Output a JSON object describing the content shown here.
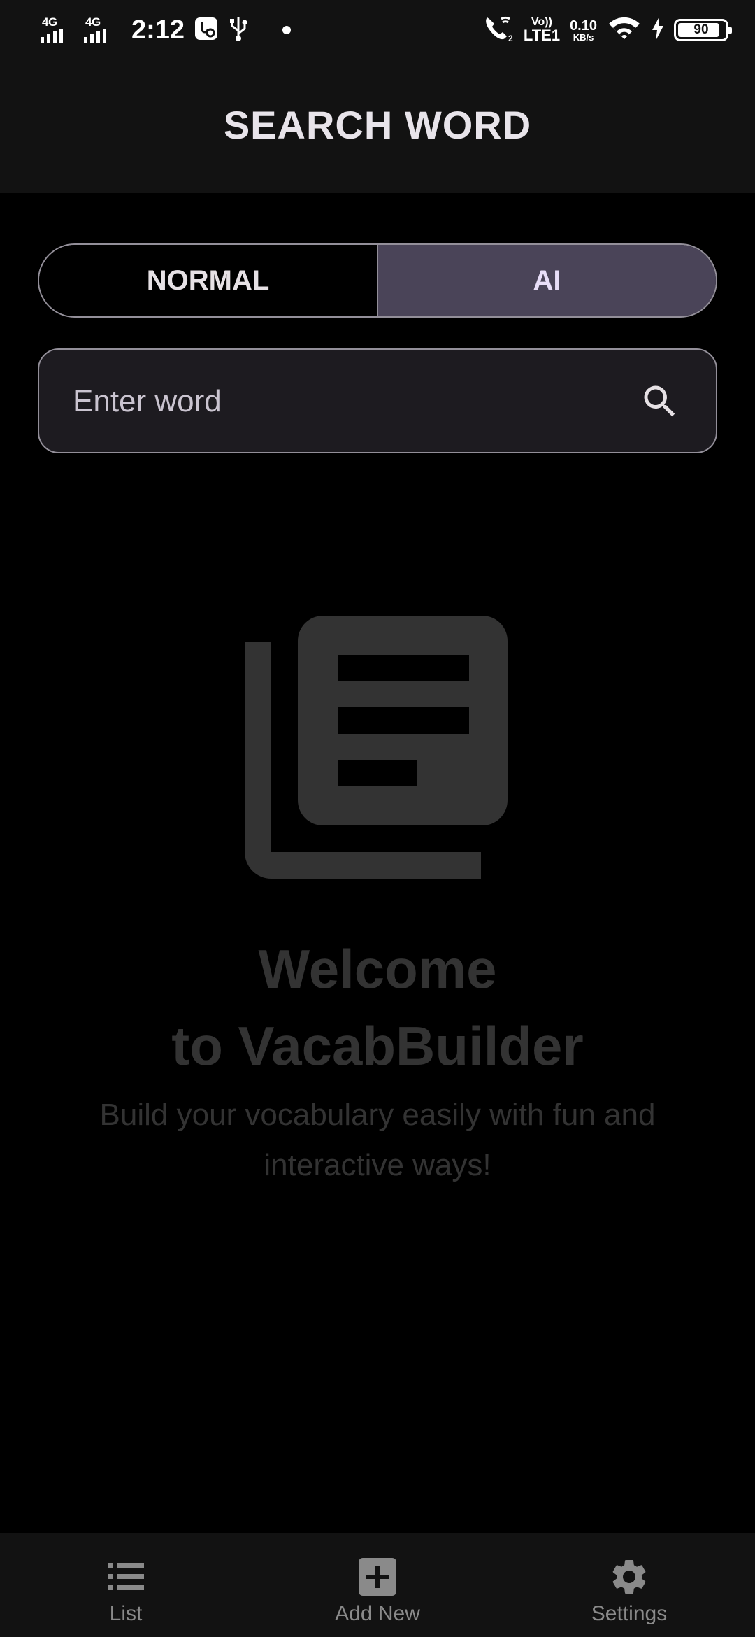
{
  "status_bar": {
    "network_1": "4G",
    "network_2": "4G",
    "time": "2:12",
    "volte_top": "Vo))",
    "volte_bottom": "LTE1",
    "speed_value": "0.10",
    "speed_unit": "KB/s",
    "battery_level": "90"
  },
  "header": {
    "title": "SEARCH WORD"
  },
  "mode_toggle": {
    "normal_label": "NORMAL",
    "ai_label": "AI",
    "selected": "AI"
  },
  "search": {
    "placeholder": "Enter word",
    "value": ""
  },
  "empty_state": {
    "title_line1": "Welcome",
    "title_line2": "to VacabBuilder",
    "subtitle": "Build your vocabulary easily with fun and interactive ways!"
  },
  "bottom_nav": {
    "items": [
      {
        "label": "List",
        "icon": "list-icon"
      },
      {
        "label": "Add New",
        "icon": "add-box-icon"
      },
      {
        "label": "Settings",
        "icon": "settings-icon"
      }
    ]
  },
  "colors": {
    "background": "#000000",
    "surface": "#121212",
    "selected_segment": "#4a4458",
    "outline": "#938f99",
    "muted_text": "#333333",
    "nav_inactive": "#8a8a8a"
  }
}
